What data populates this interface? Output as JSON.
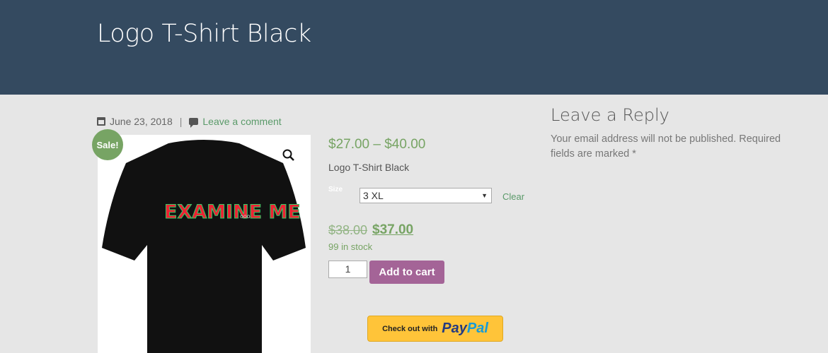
{
  "header": {
    "title": "Logo T-Shirt Black"
  },
  "meta": {
    "date": "June 23, 2018",
    "separator": "|",
    "comment_link": "Leave a comment"
  },
  "product": {
    "sale_badge": "Sale!",
    "price_range": "$27.00 – $40.00",
    "short_description": "Logo T-Shirt Black",
    "size_label": "Size",
    "size_selected": "3 XL",
    "clear_label": "Clear",
    "old_price": "$38.00",
    "new_price": "$37.00",
    "stock": "99 in stock",
    "quantity": "1",
    "add_to_cart": "Add to cart",
    "shirt_print": "EXAMINE ME",
    "shirt_print_suffix": "ooo",
    "paypal_prefix": "Check out with",
    "paypal_brand_1": "Pay",
    "paypal_brand_2": "Pal"
  },
  "reply": {
    "title": "Leave a Reply",
    "note": "Your email address will not be published. Required fields are marked *"
  },
  "colors": {
    "header_bg": "#344a60",
    "accent_green": "#77a464",
    "add_to_cart": "#a46497",
    "paypal": "#ffc439"
  }
}
